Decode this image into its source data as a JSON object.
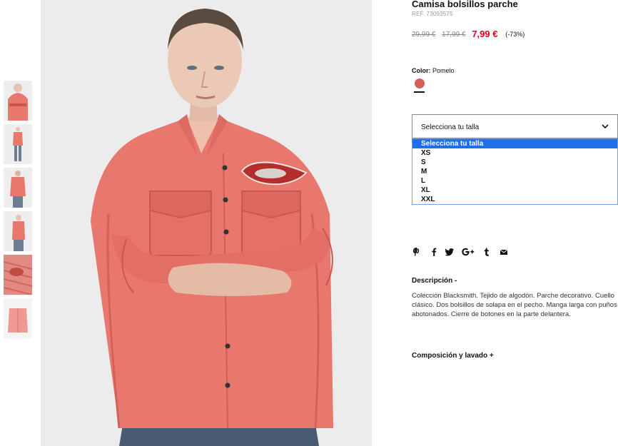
{
  "product": {
    "title": "Camisa bolsillos parche",
    "ref": "REF. 73093575",
    "price_original": "29,99 €",
    "price_previous": "17,99 €",
    "price_current": "7,99 €",
    "discount": "(-73%)"
  },
  "color": {
    "label": "Color:",
    "value": "Pomelo",
    "swatch": "#d6615a"
  },
  "size": {
    "select_label": "Selecciona tu talla",
    "options": [
      "Selecciona tu talla",
      "XS",
      "S",
      "M",
      "L",
      "XL",
      "XXL"
    ],
    "selected_index": 0
  },
  "share": {
    "icons": [
      "pinterest-icon",
      "facebook-icon",
      "twitter-icon",
      "google-plus-icon",
      "tumblr-icon",
      "email-icon"
    ]
  },
  "description": {
    "title": "Descripción -",
    "text": "Colección Blacksmith. Tejido de algodón. Parche decorativo. Cuello clásico. Dos bolsillos de solapa en el pecho. Manga larga con puños abotonados. Cierre de botones en la parte delantera."
  },
  "composition": {
    "title": "Composición y lavado +"
  },
  "colors": {
    "accent_price": "#e1001a",
    "dropdown_highlight": "#1e6fe8",
    "shirt": "#e8776e"
  }
}
